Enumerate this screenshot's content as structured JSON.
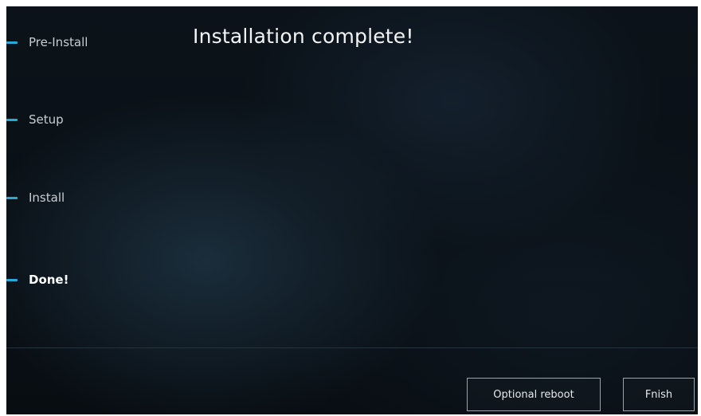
{
  "steps": [
    {
      "label": "Pre-Install",
      "active": false
    },
    {
      "label": "Setup",
      "active": false
    },
    {
      "label": "Install",
      "active": false
    },
    {
      "label": "Done!",
      "active": true
    }
  ],
  "main": {
    "title": "Installation complete!"
  },
  "footer": {
    "optional_reboot_label": "Optional reboot",
    "finish_label": "Fnish"
  },
  "colors": {
    "accent": "#2aa8d8",
    "background": "#0a1016"
  }
}
